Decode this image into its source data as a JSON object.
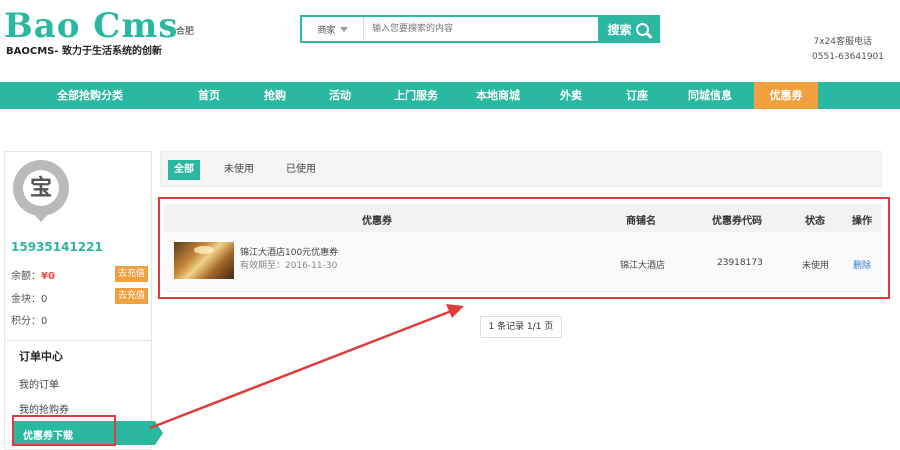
{
  "header": {
    "logo": "Bao Cms",
    "slogan": "BAOCMS- 致力于生活系统的创新",
    "city": "合肥",
    "search": {
      "type": "商家",
      "placeholder": "输入您要搜索的内容",
      "button": "搜索"
    },
    "hotline_label": "7x24客服电话",
    "hotline_number": "0551-63641901"
  },
  "nav": {
    "items": [
      "全部抢购分类",
      "首页",
      "抢购",
      "活动",
      "上门服务",
      "本地商城",
      "外卖",
      "订座",
      "同城信息",
      "优惠券"
    ],
    "active": "优惠券"
  },
  "sidebar": {
    "avatar_char": "宝",
    "phone": "15935141221",
    "balance_label": "余额：",
    "balance_value": "¥0",
    "gold_label": "金块：0",
    "points_label": "积分：0",
    "recharge": "去充值",
    "menu_title": "订单中心",
    "menu_items": [
      "我的订单",
      "我的抢购券",
      "优惠券下载"
    ]
  },
  "main": {
    "tabs": [
      "全部",
      "未使用",
      "已使用"
    ],
    "columns": [
      "优惠券",
      "商铺名",
      "优惠券代码",
      "状态",
      "操作"
    ],
    "rows": [
      {
        "title": "锦江大酒店100元优惠券",
        "expiry": "有效期至：2016-11-30",
        "shop": "锦江大酒店",
        "code": "23918173",
        "status": "未使用",
        "action": "删除"
      }
    ],
    "pagination": "1 条记录 1/1 页"
  },
  "colors": {
    "accent": "#2bb8a0",
    "active_nav": "#f0a03c",
    "highlight": "#e03b3b"
  }
}
